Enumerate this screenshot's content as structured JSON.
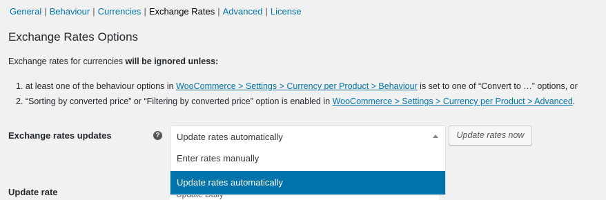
{
  "subnav": {
    "items": [
      "General",
      "Behaviour",
      "Currencies",
      "Exchange Rates",
      "Advanced",
      "License"
    ],
    "current_index": 3
  },
  "page": {
    "title": "Exchange Rates Options",
    "intro_prefix": "Exchange rates for currencies ",
    "intro_bold": "will be ignored unless:",
    "rule1_prefix": "1. at least one of the behaviour options in ",
    "rule1_link": "WooCommerce > Settings > Currency per Product > Behaviour",
    "rule1_suffix": " is set to one of “Convert to …” options, or",
    "rule2_prefix": "2. “Sorting by converted price” or “Filtering by converted price” option is enabled in ",
    "rule2_link": "WooCommerce > Settings > Currency per Product > Advanced",
    "rule2_suffix": "."
  },
  "exchange_rates_updates": {
    "label": "Exchange rates updates",
    "help_icon": "question-circle-icon",
    "help_glyph": "?",
    "selected": "Update rates automatically",
    "options": [
      "Enter rates manually",
      "Update rates automatically"
    ],
    "highlighted_index": 1,
    "button_label": "Update rates now"
  },
  "update_rate": {
    "label": "Update rate",
    "selected": "Update Daily"
  },
  "colors": {
    "link": "#0073aa",
    "highlight": "#0073aa",
    "background": "#f1f1f1"
  }
}
